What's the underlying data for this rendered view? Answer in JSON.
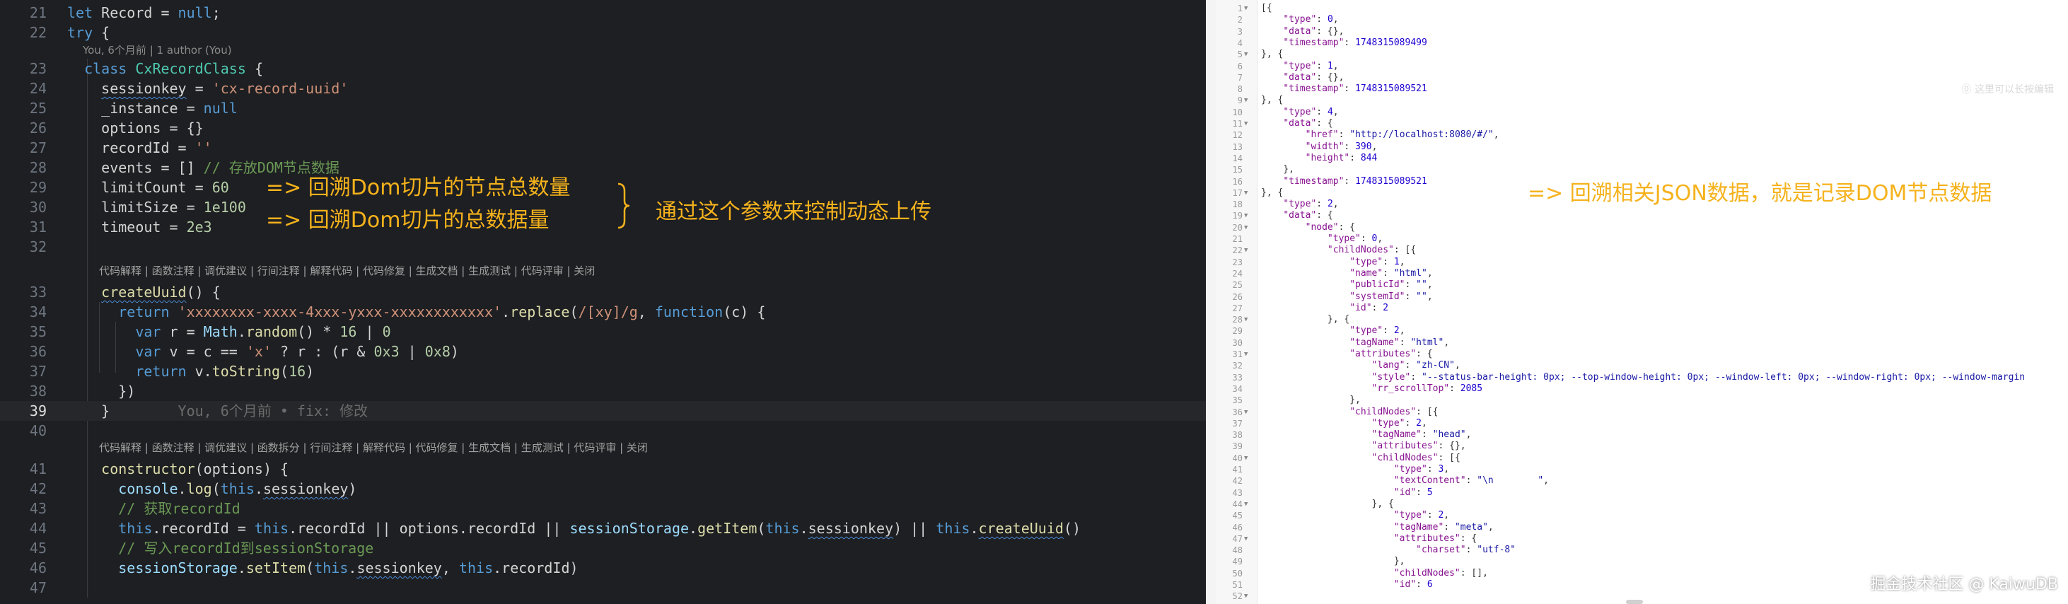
{
  "left_editor": {
    "blame_header": "You, 6个月前 | 1 author (You)",
    "codelens_1": "代码解释 | 函数注释 | 调优建议 | 行间注释 | 解释代码 | 代码修复 | 生成文档 | 生成测试 | 代码评审 | 关闭",
    "codelens_2": "代码解释 | 函数注释 | 调优建议 | 函数拆分 | 行间注释 | 解释代码 | 代码修复 | 生成文档 | 生成测试 | 代码评审 | 关闭",
    "inline_blame": "You, 6个月前 • fix: 修改",
    "lines": [
      {
        "n": "21",
        "text": "let Record = null;"
      },
      {
        "n": "22",
        "text": "try {"
      },
      {
        "n": "23",
        "text": "  class CxRecordClass {"
      },
      {
        "n": "24",
        "text": "    sessionkey = 'cx-record-uuid'"
      },
      {
        "n": "25",
        "text": "    _instance = null"
      },
      {
        "n": "26",
        "text": "    options = {}"
      },
      {
        "n": "27",
        "text": "    recordId = ''"
      },
      {
        "n": "28",
        "text": "    events = [] // 存放DOM节点数据"
      },
      {
        "n": "29",
        "text": "    limitCount = 60"
      },
      {
        "n": "30",
        "text": "    limitSize = 1e100"
      },
      {
        "n": "31",
        "text": "    timeout = 2e3"
      },
      {
        "n": "32",
        "text": ""
      },
      {
        "n": "33",
        "text": "    createUuid() {"
      },
      {
        "n": "34",
        "text": "      return 'xxxxxxxx-xxxx-4xxx-yxxx-xxxxxxxxxxxx'.replace(/[xy]/g, function(c) {"
      },
      {
        "n": "35",
        "text": "        var r = Math.random() * 16 | 0"
      },
      {
        "n": "36",
        "text": "        var v = c == 'x' ? r : (r & 0x3 | 0x8)"
      },
      {
        "n": "37",
        "text": "        return v.toString(16)"
      },
      {
        "n": "38",
        "text": "      })"
      },
      {
        "n": "39",
        "text": "    }"
      },
      {
        "n": "40",
        "text": ""
      },
      {
        "n": "41",
        "text": "    constructor(options) {"
      },
      {
        "n": "42",
        "text": "      console.log(this.sessionkey)"
      },
      {
        "n": "43",
        "text": "      // 获取recordId"
      },
      {
        "n": "44",
        "text": "      this.recordId = this.recordId || options.recordId || sessionStorage.getItem(this.sessionkey) || this.createUuid()"
      },
      {
        "n": "45",
        "text": "      // 写入recordId到sessionStorage"
      },
      {
        "n": "46",
        "text": "      sessionStorage.setItem(this.sessionkey, this.recordId)"
      },
      {
        "n": "47",
        "text": ""
      }
    ]
  },
  "annotations": {
    "limit_count": "=> 回溯Dom切片的节点总数量",
    "limit_size": "=> 回溯Dom切片的总数据量",
    "brace_note": "通过这个参数来控制动态上传",
    "json_note": "=> 回溯相关JSON数据，就是记录DOM节点数据"
  },
  "right_editor": {
    "ghost_hint": "⓪ 这里可以长按编辑",
    "lines": [
      {
        "n": "1",
        "fold": true,
        "text": "[{"
      },
      {
        "n": "2",
        "text": "    \"type\": 0,"
      },
      {
        "n": "3",
        "text": "    \"data\": {},"
      },
      {
        "n": "4",
        "text": "    \"timestamp\": 1748315089499"
      },
      {
        "n": "5",
        "fold": true,
        "text": "}, {"
      },
      {
        "n": "6",
        "text": "    \"type\": 1,"
      },
      {
        "n": "7",
        "text": "    \"data\": {},"
      },
      {
        "n": "8",
        "text": "    \"timestamp\": 1748315089521"
      },
      {
        "n": "9",
        "fold": true,
        "text": "}, {"
      },
      {
        "n": "10",
        "text": "    \"type\": 4,"
      },
      {
        "n": "11",
        "fold": true,
        "text": "    \"data\": {"
      },
      {
        "n": "12",
        "text": "        \"href\": \"http://localhost:8080/#/\","
      },
      {
        "n": "13",
        "text": "        \"width\": 390,"
      },
      {
        "n": "14",
        "text": "        \"height\": 844"
      },
      {
        "n": "15",
        "text": "    },"
      },
      {
        "n": "16",
        "text": "    \"timestamp\": 1748315089521"
      },
      {
        "n": "17",
        "fold": true,
        "text": "}, {"
      },
      {
        "n": "18",
        "text": "    \"type\": 2,"
      },
      {
        "n": "19",
        "fold": true,
        "text": "    \"data\": {"
      },
      {
        "n": "20",
        "fold": true,
        "text": "        \"node\": {"
      },
      {
        "n": "21",
        "text": "            \"type\": 0,"
      },
      {
        "n": "22",
        "fold": true,
        "text": "            \"childNodes\": [{"
      },
      {
        "n": "23",
        "text": "                \"type\": 1,"
      },
      {
        "n": "24",
        "text": "                \"name\": \"html\","
      },
      {
        "n": "25",
        "text": "                \"publicId\": \"\","
      },
      {
        "n": "26",
        "text": "                \"systemId\": \"\","
      },
      {
        "n": "27",
        "text": "                \"id\": 2"
      },
      {
        "n": "28",
        "fold": true,
        "text": "            }, {"
      },
      {
        "n": "29",
        "text": "                \"type\": 2,"
      },
      {
        "n": "30",
        "text": "                \"tagName\": \"html\","
      },
      {
        "n": "31",
        "fold": true,
        "text": "                \"attributes\": {"
      },
      {
        "n": "32",
        "text": "                    \"lang\": \"zh-CN\","
      },
      {
        "n": "33",
        "text": "                    \"style\": \"--status-bar-height: 0px; --top-window-height: 0px; --window-left: 0px; --window-right: 0px; --window-margin"
      },
      {
        "n": "34",
        "text": "                    \"rr_scrollTop\": 2085"
      },
      {
        "n": "35",
        "text": "                },"
      },
      {
        "n": "36",
        "fold": true,
        "text": "                \"childNodes\": [{"
      },
      {
        "n": "37",
        "text": "                    \"type\": 2,"
      },
      {
        "n": "38",
        "text": "                    \"tagName\": \"head\","
      },
      {
        "n": "39",
        "text": "                    \"attributes\": {},"
      },
      {
        "n": "40",
        "fold": true,
        "text": "                    \"childNodes\": [{"
      },
      {
        "n": "41",
        "text": "                        \"type\": 3,"
      },
      {
        "n": "42",
        "text": "                        \"textContent\": \"\\n        \","
      },
      {
        "n": "43",
        "text": "                        \"id\": 5"
      },
      {
        "n": "44",
        "fold": true,
        "text": "                    }, {"
      },
      {
        "n": "45",
        "text": "                        \"type\": 2,"
      },
      {
        "n": "46",
        "text": "                        \"tagName\": \"meta\","
      },
      {
        "n": "47",
        "fold": true,
        "text": "                        \"attributes\": {"
      },
      {
        "n": "48",
        "text": "                            \"charset\": \"utf-8\""
      },
      {
        "n": "49",
        "text": "                        },"
      },
      {
        "n": "50",
        "text": "                        \"childNodes\": [],"
      },
      {
        "n": "51",
        "text": "                        \"id\": 6"
      },
      {
        "n": "52",
        "fold": true,
        "text": ""
      }
    ]
  },
  "watermark": "掘金技术社区 @ KaiwuDB",
  "colors": {
    "annotation": "#f5b21c",
    "editor_bg": "#1e1f22",
    "json_key": "#881391",
    "json_string": "#1a1aa6",
    "json_number": "#1c00cf"
  }
}
